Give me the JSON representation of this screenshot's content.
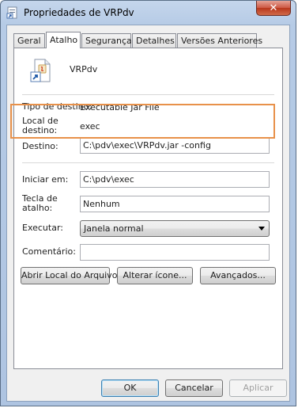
{
  "window": {
    "title": "Propriedades de VRPdv",
    "close_label": "✕"
  },
  "tabs": [
    {
      "label": "Geral",
      "active": false
    },
    {
      "label": "Atalho",
      "active": true
    },
    {
      "label": "Segurança",
      "active": false
    },
    {
      "label": "Detalhes",
      "active": false
    },
    {
      "label": "Versões Anteriores",
      "active": false
    }
  ],
  "shortcut": {
    "name": "VRPdv",
    "target_type_label": "Tipo de destino:",
    "target_type_value": "Executable Jar File",
    "target_location_label_1": "Local de",
    "target_location_label_2": "destino:",
    "target_location_value": "exec",
    "target_label": "Destino:",
    "target_value": "C:\\pdv\\exec\\VRPdv.jar -config",
    "start_in_label": "Iniciar em:",
    "start_in_value": "C:\\pdv\\exec",
    "hotkey_label_1": "Tecla de",
    "hotkey_label_2": "atalho:",
    "hotkey_value": "Nenhum",
    "run_label": "Executar:",
    "run_value": "Janela normal",
    "comment_label": "Comentário:",
    "comment_value": ""
  },
  "actions": {
    "open_location": "Abrir Local do Arquivo",
    "change_icon": "Alterar ícone...",
    "advanced": "Avançados..."
  },
  "footer": {
    "ok": "OK",
    "cancel": "Cancelar",
    "apply": "Aplicar"
  },
  "colors": {
    "highlight_border": "#e8914a"
  }
}
